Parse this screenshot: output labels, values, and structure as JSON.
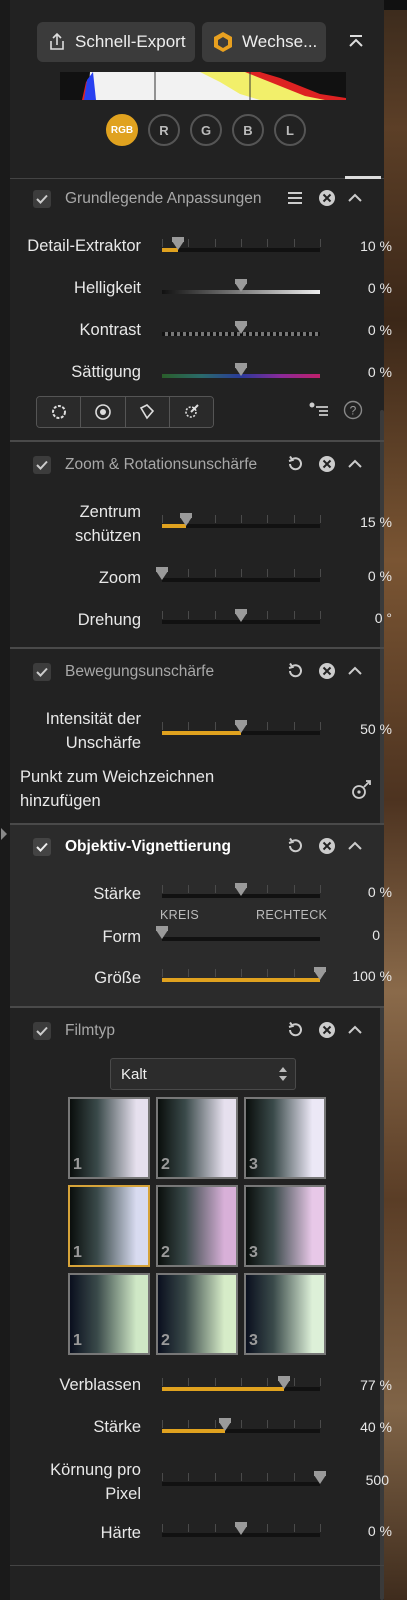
{
  "toolbar": {
    "quick_export_label": "Schnell-Export",
    "switch_label": "Wechse...",
    "share_icon": "share-icon",
    "app_icon": "app-logo-icon",
    "collapse_icon": "collapse-up-icon"
  },
  "histogram": {
    "channels": [
      "RGB",
      "R",
      "G",
      "B",
      "L"
    ],
    "active_channel": "RGB"
  },
  "basic_adjustments": {
    "title": "Grundlegende Anpassungen",
    "sliders": [
      {
        "label": "Detail-Extraktor",
        "value": "10 %",
        "level": 0.1
      },
      {
        "label": "Helligkeit",
        "value": "0 %",
        "level": 0.5
      },
      {
        "label": "Kontrast",
        "value": "0 %",
        "level": 0.5
      },
      {
        "label": "Sättigung",
        "value": "0 %",
        "level": 0.5
      }
    ],
    "tools": [
      "circle-mask-icon",
      "radial-mask-icon",
      "polygon-mask-icon",
      "brush-mask-icon"
    ]
  },
  "zoom_blur": {
    "title": "Zoom & Rotationsunschärfe",
    "sliders": [
      {
        "label": "Zentrum\nschützen",
        "value": "15 %",
        "level": 0.15
      },
      {
        "label": "Zoom",
        "value": "0 %",
        "level": 0.0
      },
      {
        "label": "Drehung",
        "value": "0 °",
        "level": 0.5
      }
    ]
  },
  "motion_blur": {
    "title": "Bewegungsunschärfe",
    "intensity_label": "Intensität der\nUnschärfe",
    "intensity_value": "50 %",
    "intensity_level": 0.5,
    "add_point_label": "Punkt zum Weichzeichnen\nhinzufügen"
  },
  "vignette": {
    "title": "Objektiv-Vignettierung",
    "strength_label": "Stärke",
    "strength_value": "0 %",
    "strength_level": 0.5,
    "shape_label": "Form",
    "shape_min": "KREIS",
    "shape_max": "RECHTECK",
    "shape_value": "0",
    "shape_level": 0.0,
    "size_label": "Größe",
    "size_value": "100 %",
    "size_level": 1.0
  },
  "film_type": {
    "title": "Filmtyp",
    "preset": "Kalt",
    "presets": [
      {
        "num": "1",
        "tint": "#e6e0ee",
        "selected": false
      },
      {
        "num": "2",
        "tint": "#e6e0ee",
        "selected": false
      },
      {
        "num": "3",
        "tint": "#ece8f6",
        "selected": false
      },
      {
        "num": "1",
        "tint": "#d8dbf0",
        "selected": true
      },
      {
        "num": "2",
        "tint": "#d8b0d8",
        "selected": false
      },
      {
        "num": "3",
        "tint": "#e8c8e8",
        "selected": false
      },
      {
        "num": "1",
        "tint": "#cfe8c6",
        "selected": false
      },
      {
        "num": "2",
        "tint": "#d6ecc8",
        "selected": false
      },
      {
        "num": "3",
        "tint": "#ddf0d8",
        "selected": false
      }
    ],
    "sliders": [
      {
        "label": "Verblassen",
        "value": "77 %",
        "level": 0.77
      },
      {
        "label": "Stärke",
        "value": "40 %",
        "level": 0.4
      },
      {
        "label": "Körnung pro\nPixel",
        "value": "500",
        "level": 1.0
      },
      {
        "label": "Härte",
        "value": "0 %",
        "level": 0.5
      }
    ]
  },
  "colors": {
    "accent": "#e0a21f",
    "panel": "#222222"
  }
}
